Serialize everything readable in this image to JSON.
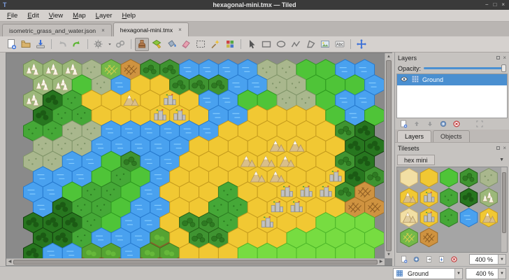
{
  "window": {
    "title": "hexagonal-mini.tmx — Tiled",
    "app_icon": "T",
    "controls": [
      "−",
      "□",
      "×"
    ]
  },
  "menu": {
    "items": [
      "File",
      "Edit",
      "View",
      "Map",
      "Layer",
      "Help"
    ]
  },
  "tabs": [
    {
      "label": "isometric_grass_and_water.json",
      "close": "×",
      "active": false
    },
    {
      "label": "hexagonal-mini.tmx",
      "close": "×",
      "active": true
    }
  ],
  "toolbar": {
    "active": "stamp-brush",
    "icons": [
      "new-file",
      "open-file",
      "save",
      "sep",
      "undo",
      "redo",
      "sep",
      "snap-settings",
      "caret",
      "link",
      "sep",
      "stamp-brush",
      "terrain-brush",
      "bucket-fill",
      "eraser",
      "rect-select",
      "magic-wand",
      "tile-picker",
      "sep",
      "select-object",
      "rect-object",
      "ellipse-object",
      "polyline-object",
      "polygon-object",
      "tile-object",
      "text-object",
      "sep",
      "move-view"
    ]
  },
  "layers_panel": {
    "title": "Layers",
    "opacity_label": "Opacity:",
    "opacity_value": 1,
    "layers": [
      {
        "name": "Ground",
        "visible": true,
        "selected": true
      }
    ],
    "buttons": [
      "new-file",
      "arrow-up",
      "arrow-down",
      "duplicate",
      "remove",
      "highlight"
    ],
    "tabs": [
      {
        "label": "Layers",
        "active": true
      },
      {
        "label": "Objects",
        "active": false
      }
    ]
  },
  "tilesets_panel": {
    "title": "Tilesets",
    "tab": "hex mini",
    "buttons": [
      "new-file",
      "duplicate",
      "embed",
      "export",
      "remove"
    ],
    "zoom_value": "400 %"
  },
  "statusbar": {
    "layer_combo": "Ground",
    "zoom_combo": "400 %"
  },
  "map": {
    "rows": [
      "TTTPFfddWWWWPPGGWW",
      "TTGPWSSdddWWPPGGGW",
      "TDgSSMSCSWWGGPPGWW",
      "DggSSSCCSWWSSSSGWG",
      "ggPPWWWWWWSSSSSSdD",
      "PPPWWWWWSSSSMMSSDD",
      "PPWWGdWWSSSMMMSSdD",
      "WWWGgGWSSSSMMSSCDd",
      "WWGggGWSSSgSSCCCdf",
      "WDggGWWSSggSCCSSff",
      "DDDgGWWSddgSCSSLLL",
      "DDgWWWBSddSSSLLLLL",
      "DWWBBWBBSSSLLLLLLL"
    ],
    "types": {
      "W": {
        "name": "water",
        "fill": "#49a1ef",
        "edge": "#2679cd",
        "deco": "waves",
        "deco_color": "#8bd0ff"
      },
      "S": {
        "name": "sand",
        "fill": "#f1c833",
        "edge": "#c59b1d"
      },
      "s": {
        "name": "light-sand",
        "fill": "#f2dfa4",
        "edge": "#cdb272"
      },
      "G": {
        "name": "green",
        "fill": "#4fc438",
        "edge": "#2e9a20"
      },
      "L": {
        "name": "light-green",
        "fill": "#77dc41",
        "edge": "#4cb629"
      },
      "g": {
        "name": "grass",
        "fill": "#45a837",
        "edge": "#2c7d22",
        "deco": "dots",
        "deco_color": "#2c7d22"
      },
      "P": {
        "name": "sage",
        "fill": "#a9b78d",
        "edge": "#7f9468",
        "deco": "dots",
        "deco_color": "#7f9468"
      },
      "d": {
        "name": "dark-bumpy",
        "fill": "#3f9431",
        "edge": "#235f16",
        "deco": "bumps",
        "deco_color": "#2e7a22"
      },
      "D": {
        "name": "forest",
        "fill": "#27761f",
        "edge": "#143f0e",
        "deco": "trees",
        "deco_color": "#1b5a14"
      },
      "T": {
        "name": "snow-trees",
        "fill": "#9cb87a",
        "edge": "#708c50",
        "deco": "snowtrees",
        "deco_color": "#f7f2e2"
      },
      "M": {
        "name": "sand-mountain",
        "fill": "#f1c833",
        "edge": "#c59b1d",
        "deco": "mountain",
        "deco_color": "#d9bf8a"
      },
      "m": {
        "name": "dune-mountain",
        "fill": "#f2dfa4",
        "edge": "#cdb272",
        "deco": "mountain",
        "deco_color": "#e2cfa0"
      },
      "C": {
        "name": "castle",
        "fill": "#f1c833",
        "edge": "#c59b1d",
        "deco": "castle",
        "deco_color": "#c2c2c2"
      },
      "F": {
        "name": "farm-green",
        "fill": "#74b84a",
        "edge": "#4c8a28",
        "deco": "hatch",
        "deco_color": "#d9d04e"
      },
      "f": {
        "name": "farm-orange",
        "fill": "#cf9340",
        "edge": "#a06c24",
        "deco": "hatch",
        "deco_color": "#8a5a22"
      },
      "B": {
        "name": "bush-dirt",
        "fill": "#55a332",
        "edge": "#3f7a22",
        "deco": "bush",
        "deco_color": "#8a5a2a"
      }
    }
  },
  "palette": {
    "tiles": [
      "s",
      "S",
      "G",
      "d",
      "P",
      "M",
      "C",
      "g",
      "D",
      "T",
      "m",
      "C",
      "g",
      "W",
      "M",
      "F",
      "f"
    ]
  }
}
